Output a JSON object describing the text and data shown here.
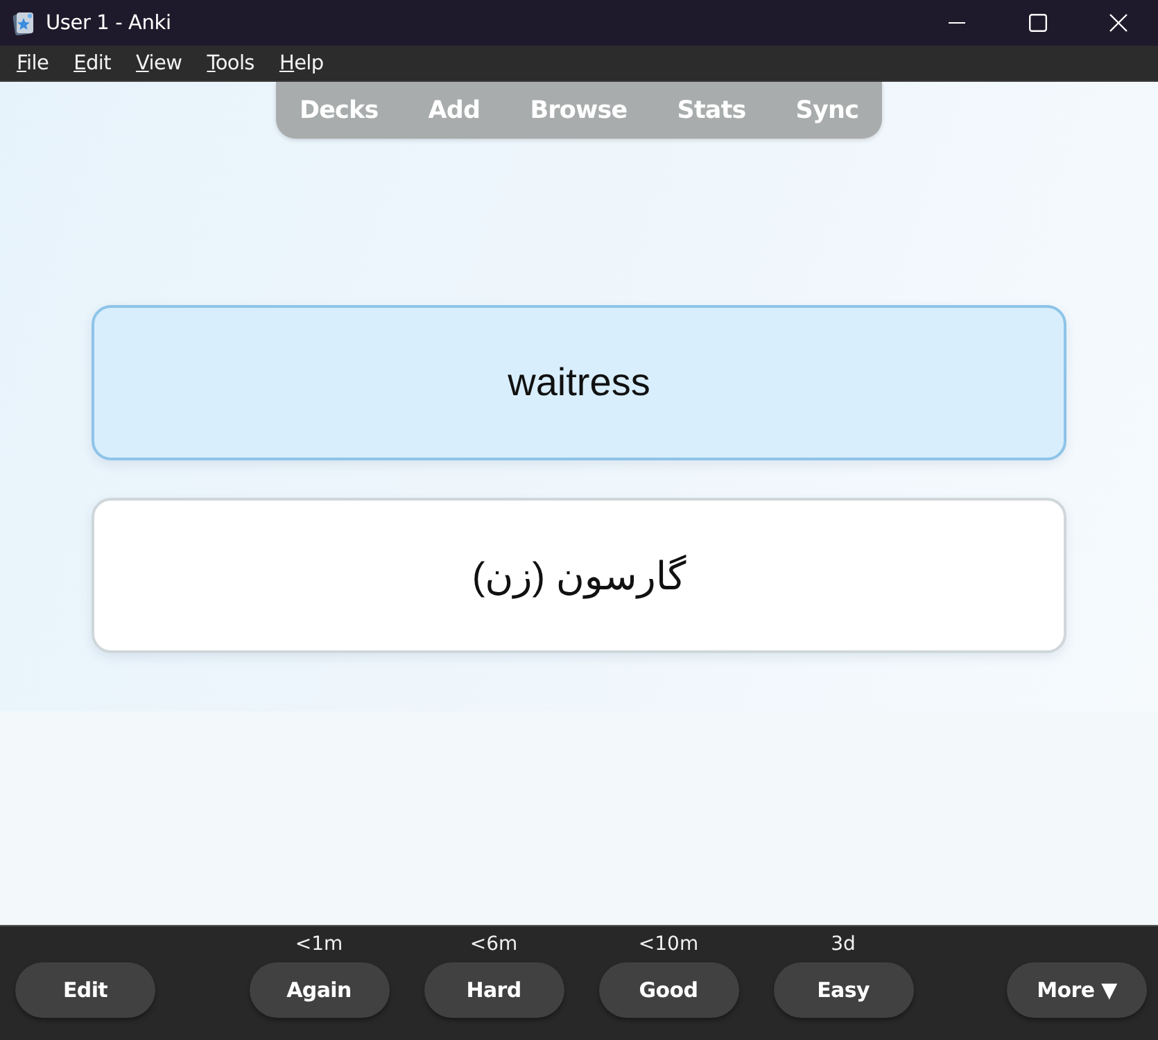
{
  "window": {
    "title": "User 1 - Anki"
  },
  "menu": [
    {
      "label": "File",
      "mnemonic_first": true
    },
    {
      "label": "Edit",
      "mnemonic_first": true
    },
    {
      "label": "View",
      "mnemonic_first": true
    },
    {
      "label": "Tools",
      "mnemonic_first": true
    },
    {
      "label": "Help",
      "mnemonic_first": true
    }
  ],
  "toolbar": [
    "Decks",
    "Add",
    "Browse",
    "Stats",
    "Sync"
  ],
  "cards": [
    {
      "kind": "question",
      "text": "waitress"
    },
    {
      "kind": "answer",
      "text": "گارسون (زن)"
    }
  ],
  "bottom_bar": {
    "edit_button": "Edit",
    "answers": [
      {
        "interval": "<1m",
        "label": "Again"
      },
      {
        "interval": "<6m",
        "label": "Hard"
      },
      {
        "interval": "<10m",
        "label": "Good"
      },
      {
        "interval": "3d",
        "label": "Easy"
      }
    ],
    "more_button": "More ▼"
  }
}
